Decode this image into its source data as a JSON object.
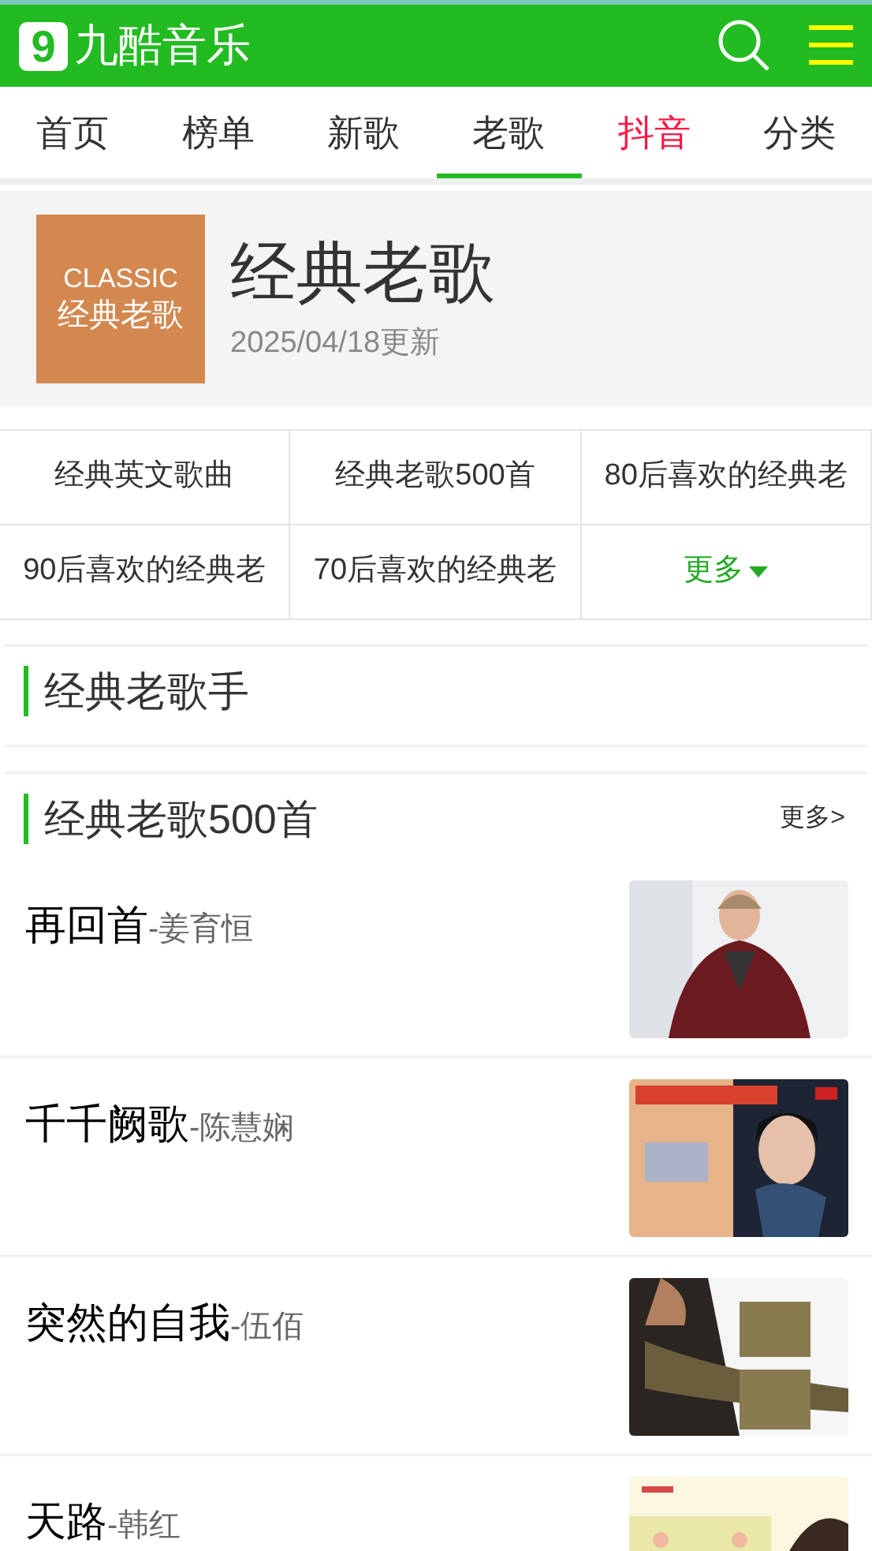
{
  "header": {
    "logo_mark": "9",
    "logo_text": "九酷音乐"
  },
  "tabs": [
    {
      "label": "首页",
      "selected": false,
      "hot": false
    },
    {
      "label": "榜单",
      "selected": false,
      "hot": false
    },
    {
      "label": "新歌",
      "selected": false,
      "hot": false
    },
    {
      "label": "老歌",
      "selected": true,
      "hot": false
    },
    {
      "label": "抖音",
      "selected": false,
      "hot": true
    },
    {
      "label": "分类",
      "selected": false,
      "hot": false
    }
  ],
  "banner": {
    "cover_en": "CLASSIC",
    "cover_cn": "经典老歌",
    "title": "经典老歌",
    "updated": "2025/04/18更新"
  },
  "categories": [
    {
      "label": "经典英文歌曲",
      "kind": "link"
    },
    {
      "label": "经典老歌500首",
      "kind": "link"
    },
    {
      "label": "80后喜欢的经典老",
      "kind": "link"
    },
    {
      "label": "90后喜欢的经典老",
      "kind": "link"
    },
    {
      "label": "70后喜欢的经典老",
      "kind": "link"
    },
    {
      "label": "更多",
      "kind": "more"
    }
  ],
  "sections": [
    {
      "title": "经典老歌手"
    },
    {
      "title": "经典老歌500首",
      "more": "更多>"
    }
  ],
  "songs": [
    {
      "title": "再回首",
      "artist": "-姜育恒",
      "kind": "picture"
    },
    {
      "title": "千千阙歌",
      "artist": "-陈慧娴",
      "kind": "picture"
    },
    {
      "title": "突然的自我",
      "artist": "-伍佰",
      "kind": "picture"
    },
    {
      "title": "天路",
      "artist": "-韩红",
      "kind": "picture"
    }
  ]
}
